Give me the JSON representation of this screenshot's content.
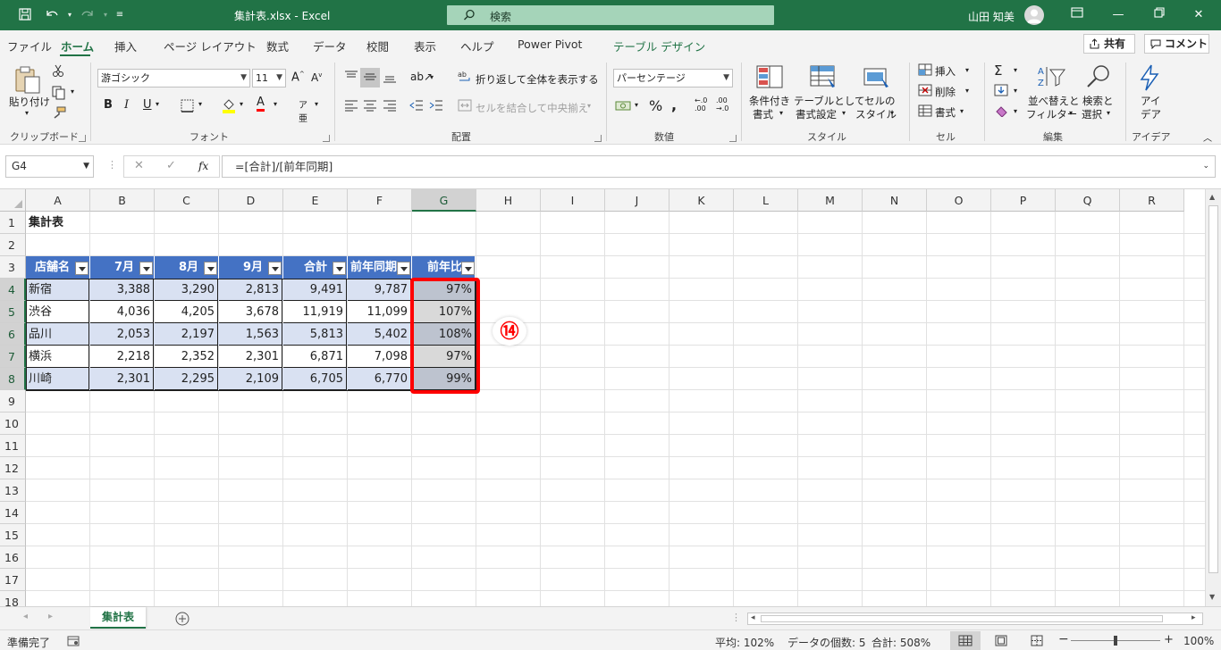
{
  "titlebar": {
    "doc_title": "集計表.xlsx  -  Excel",
    "search_label": "検索",
    "user_name": "山田 知美"
  },
  "tabs": [
    {
      "label": "ファイル"
    },
    {
      "label": "ホーム"
    },
    {
      "label": "挿入"
    },
    {
      "label": "ページ レイアウト"
    },
    {
      "label": "数式"
    },
    {
      "label": "データ"
    },
    {
      "label": "校閲"
    },
    {
      "label": "表示"
    },
    {
      "label": "ヘルプ"
    },
    {
      "label": "Power Pivot"
    },
    {
      "label": "テーブル デザイン"
    }
  ],
  "top_actions": {
    "share": "共有",
    "comment": "コメント"
  },
  "ribbon": {
    "clipboard": {
      "paste": "貼り付け",
      "group": "クリップボード"
    },
    "font": {
      "name": "游ゴシック",
      "size": "11",
      "group": "フォント"
    },
    "alignment": {
      "wrap": "折り返して全体を表示する",
      "merge": "セルを結合して中央揃え",
      "group": "配置"
    },
    "number": {
      "format": "パーセンテージ",
      "group": "数値"
    },
    "styles": {
      "conditional_1": "条件付き",
      "conditional_2": "書式",
      "table_1": "テーブルとして",
      "table_2": "書式設定",
      "cell_1": "セルの",
      "cell_2": "スタイル",
      "group": "スタイル"
    },
    "cells": {
      "insert": "挿入",
      "delete": "削除",
      "format": "書式",
      "group": "セル"
    },
    "editing": {
      "sort_1": "並べ替えと",
      "sort_2": "フィルター",
      "find_1": "検索と",
      "find_2": "選択",
      "group": "編集"
    },
    "ideas": {
      "label_1": "アイ",
      "label_2": "デア",
      "group": "アイデア"
    }
  },
  "formula_bar": {
    "name_box": "G4",
    "fx": "fx",
    "formula": "=[合計]/[前年同期]"
  },
  "columns": [
    "A",
    "B",
    "C",
    "D",
    "E",
    "F",
    "G",
    "H",
    "I",
    "J",
    "K",
    "L",
    "M",
    "N",
    "O",
    "P",
    "Q",
    "R"
  ],
  "rows": [
    "1",
    "2",
    "3",
    "4",
    "5",
    "6",
    "7",
    "8",
    "9",
    "10",
    "11",
    "12",
    "13",
    "14",
    "15",
    "16",
    "17",
    "18"
  ],
  "sheet": {
    "title": "集計表",
    "headers": [
      "店舗名",
      "7月",
      "8月",
      "9月",
      "合計",
      "前年同期",
      "前年比"
    ],
    "data": [
      [
        "新宿",
        "3,388",
        "3,290",
        "2,813",
        "9,491",
        "9,787",
        "97%"
      ],
      [
        "渋谷",
        "4,036",
        "4,205",
        "3,678",
        "11,919",
        "11,099",
        "107%"
      ],
      [
        "品川",
        "2,053",
        "2,197",
        "1,563",
        "5,813",
        "5,402",
        "108%"
      ],
      [
        "横浜",
        "2,218",
        "2,352",
        "2,301",
        "6,871",
        "7,098",
        "97%"
      ],
      [
        "川崎",
        "2,301",
        "2,295",
        "2,109",
        "6,705",
        "6,770",
        "99%"
      ]
    ]
  },
  "callout": "⑭",
  "sheet_tab": "集計表",
  "status": {
    "ready": "準備完了",
    "average": "平均: 102%",
    "count": "データの個数: 5",
    "sum": "合計: 508%",
    "zoom": "100%"
  },
  "colors": {
    "accent": "#217346",
    "table_header": "#4472c4",
    "band": "#d9e1f2",
    "highlight": "#ff0000"
  }
}
